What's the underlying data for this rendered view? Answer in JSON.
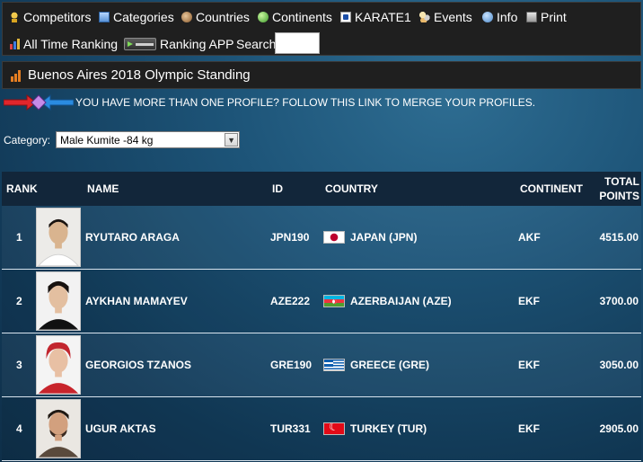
{
  "nav": {
    "competitors": "Competitors",
    "categories": "Categories",
    "countries": "Countries",
    "continents": "Continents",
    "karate1": "KARATE1",
    "events": "Events",
    "info": "Info",
    "print": "Print",
    "all_time_ranking": "All Time Ranking",
    "ranking_app": "Ranking APP",
    "search_label": "Search:",
    "search_value": ""
  },
  "page_title": "Buenos Aires 2018 Olympic Standing",
  "merge_link": "YOU HAVE MORE THAN ONE PROFILE? FOLLOW THIS LINK TO MERGE YOUR PROFILES.",
  "category": {
    "label": "Category:",
    "selected": "Male Kumite -84 kg"
  },
  "table": {
    "headers": {
      "rank": "RANK",
      "name": "NAME",
      "id": "ID",
      "country": "COUNTRY",
      "continent": "CONTINENT",
      "total_line1": "TOTAL",
      "total_line2": "POINTS"
    },
    "rows": [
      {
        "rank": "1",
        "name": "RYUTARO ARAGA",
        "id": "JPN190",
        "flag": "japan-flag",
        "country": "JAPAN (JPN)",
        "continent": "AKF",
        "points": "4515.00"
      },
      {
        "rank": "2",
        "name": "AYKHAN MAMAYEV",
        "id": "AZE222",
        "flag": "azerbaijan-flag",
        "country": "AZERBAIJAN (AZE)",
        "continent": "EKF",
        "points": "3700.00"
      },
      {
        "rank": "3",
        "name": "GEORGIOS TZANOS",
        "id": "GRE190",
        "flag": "greece-flag",
        "country": "GREECE (GRE)",
        "continent": "EKF",
        "points": "3050.00"
      },
      {
        "rank": "4",
        "name": "UGUR AKTAS",
        "id": "TUR331",
        "flag": "turkey-flag",
        "country": "TURKEY (TUR)",
        "continent": "EKF",
        "points": "2905.00"
      }
    ]
  }
}
